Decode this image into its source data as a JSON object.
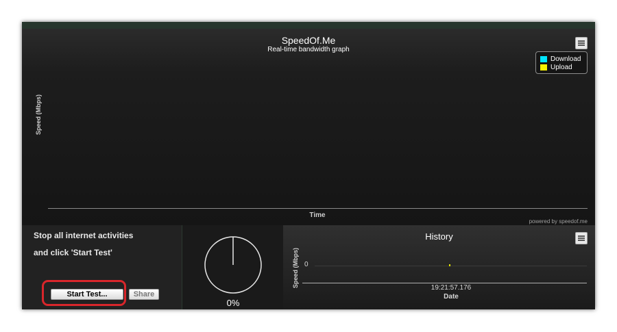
{
  "main_graph": {
    "title": "SpeedOf.Me",
    "subtitle": "Real-time bandwidth graph",
    "y_axis_label": "Speed (Mbps)",
    "x_axis_label": "Time",
    "credit": "powered by speedof.me",
    "legend": [
      {
        "label": "Download",
        "color": "#00e5ff"
      },
      {
        "label": "Upload",
        "color": "#f7f200"
      }
    ]
  },
  "instructions": {
    "line1": "Stop all internet activities",
    "line2": "and click 'Start Test'"
  },
  "buttons": {
    "start": "Start Test...",
    "share": "Share"
  },
  "gauge": {
    "percent_label": "0%",
    "progress": 0
  },
  "history": {
    "title": "History",
    "y_axis_label": "Speed (Mbps)",
    "y_tick": "0",
    "x_tick": "19:21:57.176",
    "x_axis_label": "Date"
  },
  "colors": {
    "highlight": "#d9262b",
    "background": "#141414",
    "top_strip": "#26362c"
  }
}
